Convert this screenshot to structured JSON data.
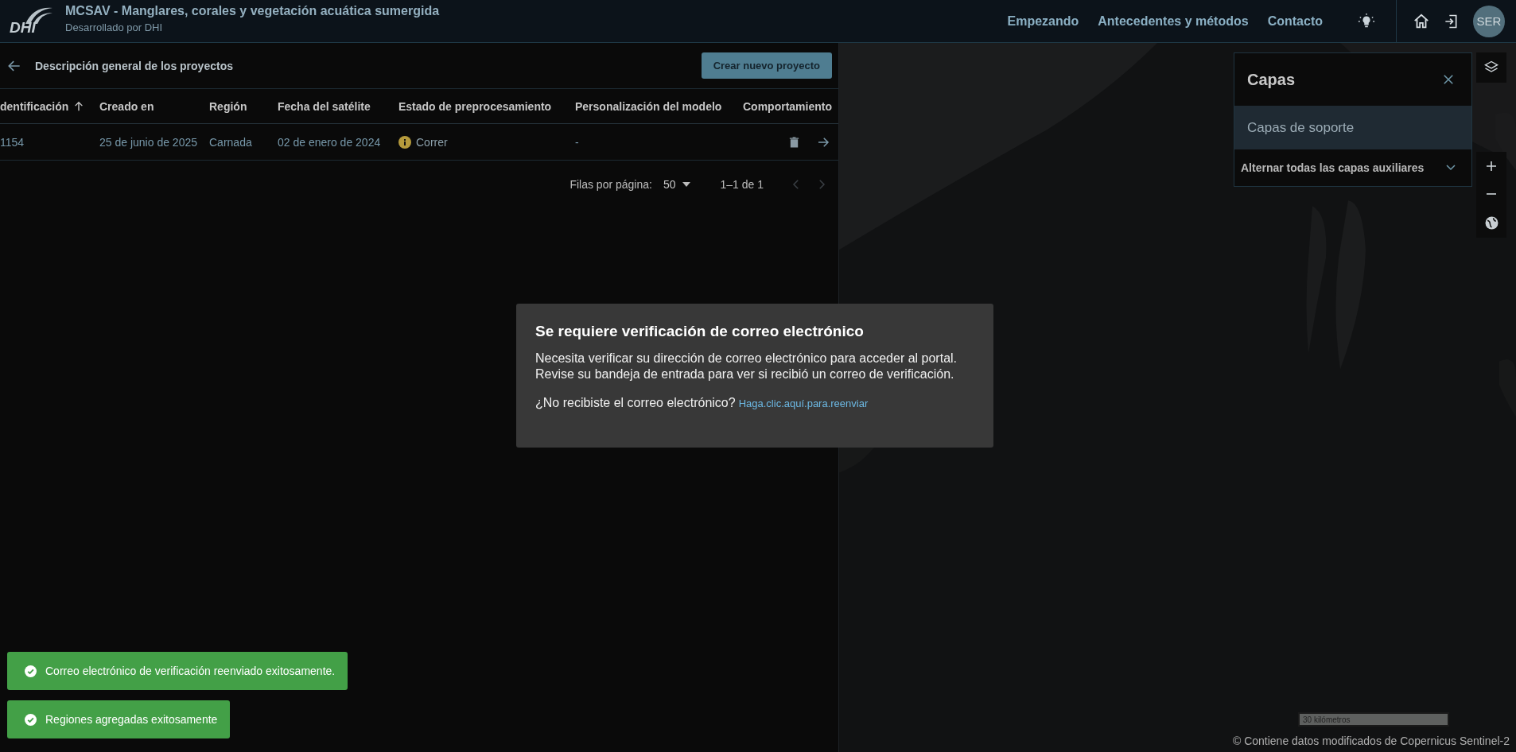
{
  "header": {
    "logo_text": "DHI",
    "title": "MCSAV - Manglares, corales y vegetación acuática sumergida",
    "subtitle": "Desarrollado por DHI",
    "nav": [
      "Empezando",
      "Antecedentes y métodos",
      "Contacto"
    ],
    "avatar": "SER"
  },
  "projects": {
    "title": "Descripción general de los proyectos",
    "create_button": "Crear nuevo proyecto",
    "columns": [
      {
        "label": "dentificación",
        "sorted": true
      },
      {
        "label": "Creado en",
        "sorted": false
      },
      {
        "label": "Región",
        "sorted": false
      },
      {
        "label": "Fecha del satélite",
        "sorted": false
      },
      {
        "label": "Estado de preprocesamiento",
        "sorted": false
      },
      {
        "label": "Personalización del modelo",
        "sorted": false
      },
      {
        "label": "Comportamiento",
        "sorted": false
      }
    ],
    "rows": [
      {
        "id": "1154",
        "created": "25 de junio de 2025",
        "region": "Carnada",
        "satellite_date": "02 de enero de 2024",
        "preprocessing": "Correr",
        "model": "-"
      }
    ],
    "pagination": {
      "rows_per_page_label": "Filas por página:",
      "rows_per_page": "50",
      "range": "1–1 de 1"
    }
  },
  "layers": {
    "title": "Capas",
    "section": "Capas de soporte",
    "toggle_all": "Alternar todas las capas auxiliares"
  },
  "map": {
    "scale": "30 kilómetros",
    "attribution": "© Contiene datos modificados de Copernicus Sentinel-2"
  },
  "dialog": {
    "title": "Se requiere verificación de correo electrónico",
    "body": [
      "Necesita verificar su dirección de correo electrónico para acceder al portal.",
      "Revise su bandeja de entrada para ver si recibió un correo de verificación."
    ],
    "question": "¿No recibiste el correo electrónico?",
    "link": "Haga.clic.aquí.para.reenviar"
  },
  "toasts": [
    {
      "kind": "success",
      "text": "Correo electrónico de verificación reenviado exitosamente."
    },
    {
      "kind": "success",
      "text": "Regiones agregadas exitosamente"
    }
  ]
}
